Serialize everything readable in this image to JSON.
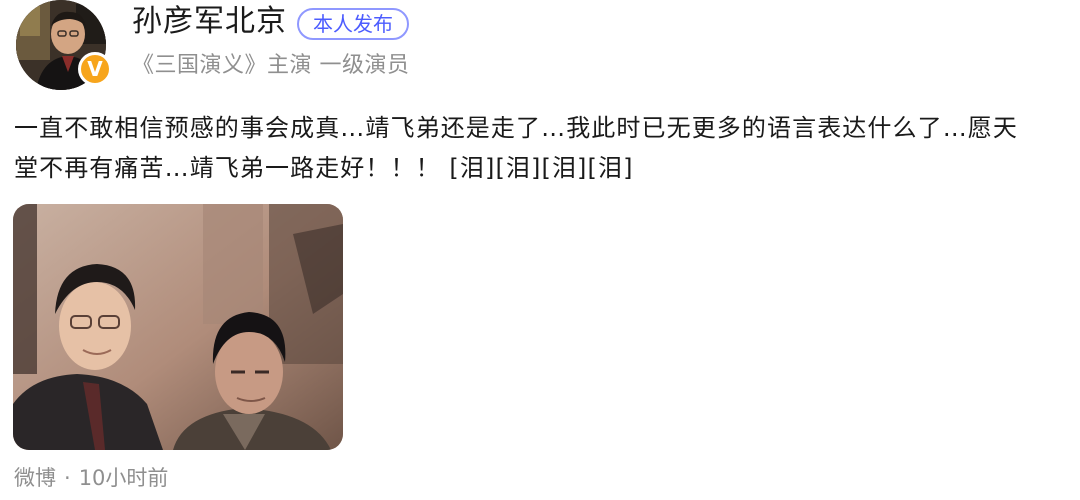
{
  "author": {
    "name": "孙彦军北京",
    "self_published_tag": "本人发布",
    "description": "《三国演义》主演 一级演员",
    "verified_badge_letter": "V",
    "verified_badge_color": "#f7a51c"
  },
  "post": {
    "text_line_1": "一直不敢相信预感的事会成真…靖飞弟还是走了…我此时已无更多的语言表达什么了…愿天",
    "text_line_2": "堂不再有痛苦…靖飞弟一路走好！！！ [泪][泪][泪][泪]"
  },
  "footer": {
    "source": "微博",
    "separator": "·",
    "time": "10小时前"
  },
  "colors": {
    "tag_border": "#8f98ff",
    "tag_text": "#4c5cff",
    "muted_text": "#8f8f8f"
  }
}
